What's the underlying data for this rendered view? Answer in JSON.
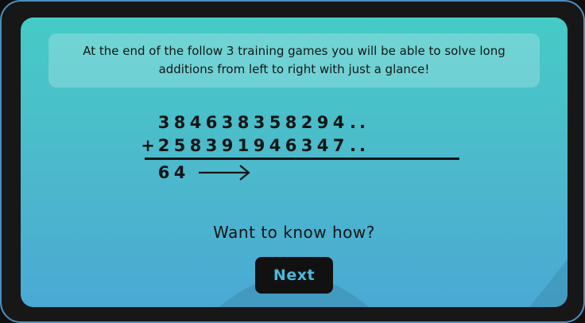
{
  "intro": {
    "text": "At the end of the follow 3 training games you will be able to solve long additions from left to right with just a glance!"
  },
  "addition": {
    "row1": {
      "sign": "",
      "digits": [
        "3",
        "8",
        "4",
        "6",
        "3",
        "8",
        "3",
        "5",
        "8",
        "2",
        "9",
        "4"
      ],
      "dots": ".."
    },
    "row2": {
      "sign": "+",
      "digits": [
        "2",
        "5",
        "8",
        "3",
        "9",
        "1",
        "9",
        "4",
        "6",
        "3",
        "4",
        "7"
      ],
      "dots": ".."
    },
    "result": {
      "digits": [
        "6",
        "4"
      ],
      "arrow_icon": "right-arrow-icon"
    }
  },
  "prompt": {
    "text": "Want to know how?"
  },
  "next_button": {
    "label": "Next"
  },
  "colors": {
    "screen_top": "#46cbc6",
    "screen_bottom": "#4aa9d4",
    "button_bg": "#111111",
    "button_text": "#49b9dd"
  }
}
